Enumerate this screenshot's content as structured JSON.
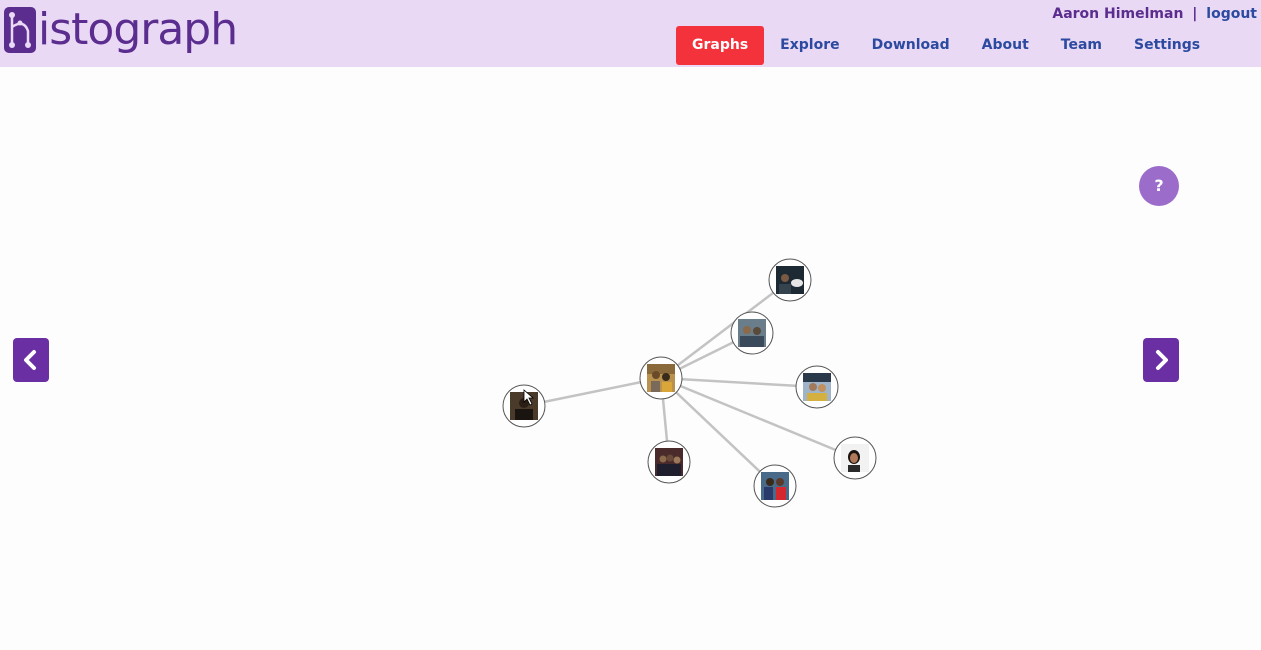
{
  "app": {
    "logo_text": "istograph"
  },
  "user_bar": {
    "username": "Aaron Himelman",
    "separator": "|",
    "logout_label": "logout"
  },
  "nav": {
    "items": [
      {
        "label": "Graphs",
        "active": true
      },
      {
        "label": "Explore",
        "active": false
      },
      {
        "label": "Download",
        "active": false
      },
      {
        "label": "About",
        "active": false
      },
      {
        "label": "Team",
        "active": false
      },
      {
        "label": "Settings",
        "active": false
      }
    ]
  },
  "help": {
    "label": "?"
  },
  "graph": {
    "center_node": {
      "id": "center",
      "photo": "two-people-photo"
    },
    "nodes": [
      {
        "id": "n1",
        "photo": "person-dark-photo"
      },
      {
        "id": "n2",
        "photo": "group-photo-1"
      },
      {
        "id": "n3",
        "photo": "outdoor-photo"
      },
      {
        "id": "n4",
        "photo": "portrait-photo"
      },
      {
        "id": "n5",
        "photo": "red-dress-photo"
      },
      {
        "id": "n6",
        "photo": "group-photo-2"
      },
      {
        "id": "n7",
        "photo": "selfie-photo"
      }
    ]
  },
  "colors": {
    "header_bg": "#e9d9f5",
    "brand": "#5b2d8e",
    "nav_active": "#f4323b",
    "nav_link": "#2b4aa0",
    "help_bg": "#9b6cc9",
    "arrow_bg": "#6a2fa3",
    "edge": "#c3c3c3"
  }
}
